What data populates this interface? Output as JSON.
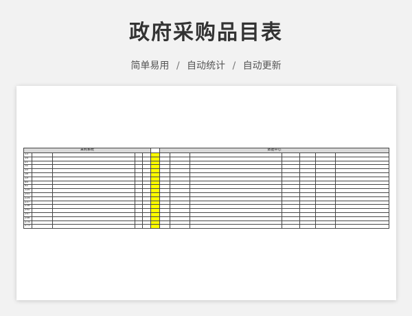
{
  "page": {
    "title": "政府采购品目表",
    "subtitle_items": [
      "简单易用",
      "自动统计",
      "自动更新"
    ],
    "separator": "/"
  },
  "sheet": {
    "header_left": "采购系统",
    "header_right": "数据中心",
    "row_numbers": [
      "13",
      "16",
      "21",
      "32",
      "35",
      "38",
      "39",
      "40",
      "42",
      "126",
      "205",
      "224",
      "257",
      "258",
      "262",
      "267",
      "268",
      "274",
      "275"
    ],
    "highlight_color": "#ffff00"
  }
}
